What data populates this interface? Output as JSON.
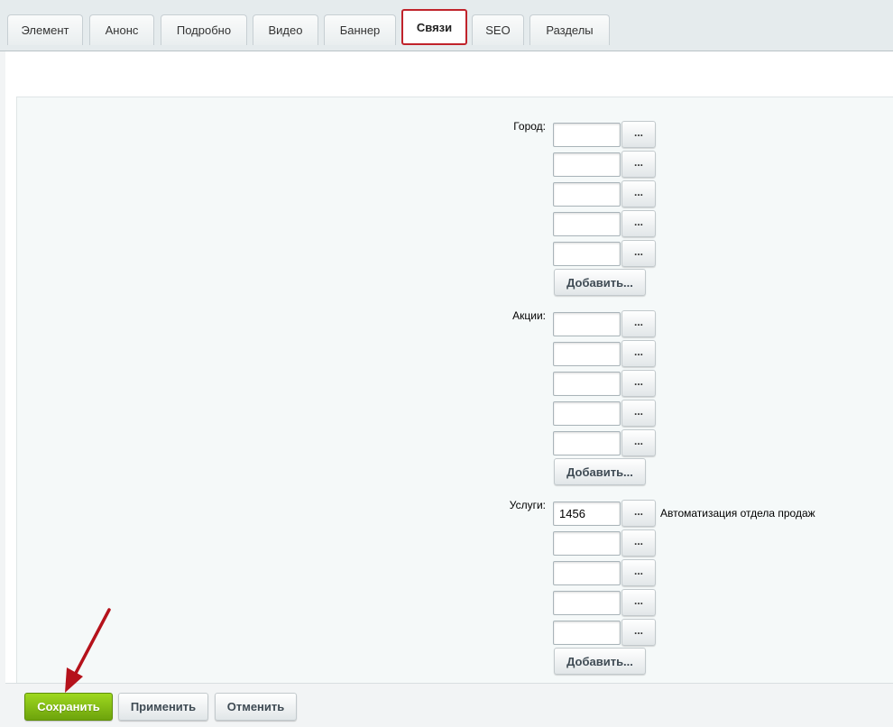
{
  "tabs": [
    {
      "label": "Элемент"
    },
    {
      "label": "Анонс"
    },
    {
      "label": "Подробно"
    },
    {
      "label": "Видео"
    },
    {
      "label": "Баннер"
    },
    {
      "label": "Связи"
    },
    {
      "label": "SEO"
    },
    {
      "label": "Разделы"
    }
  ],
  "active_tab": "Связи",
  "fields": {
    "city": {
      "label": "Город:",
      "values": [
        "",
        "",
        "",
        "",
        ""
      ],
      "browse_label": "...",
      "add_label": "Добавить..."
    },
    "promos": {
      "label": "Акции:",
      "values": [
        "",
        "",
        "",
        "",
        ""
      ],
      "browse_label": "...",
      "add_label": "Добавить..."
    },
    "services": {
      "label": "Услуги:",
      "values": [
        "1456",
        "",
        "",
        "",
        ""
      ],
      "browse_label": "...",
      "linked_name": "Автоматизация отдела продаж",
      "add_label": "Добавить..."
    }
  },
  "footer": {
    "save_label": "Сохранить",
    "apply_label": "Применить",
    "cancel_label": "Отменить"
  },
  "colors": {
    "active_tab_outline": "#c0232b",
    "save_button": "#7cb712",
    "annotation_arrow": "#b5121b"
  }
}
